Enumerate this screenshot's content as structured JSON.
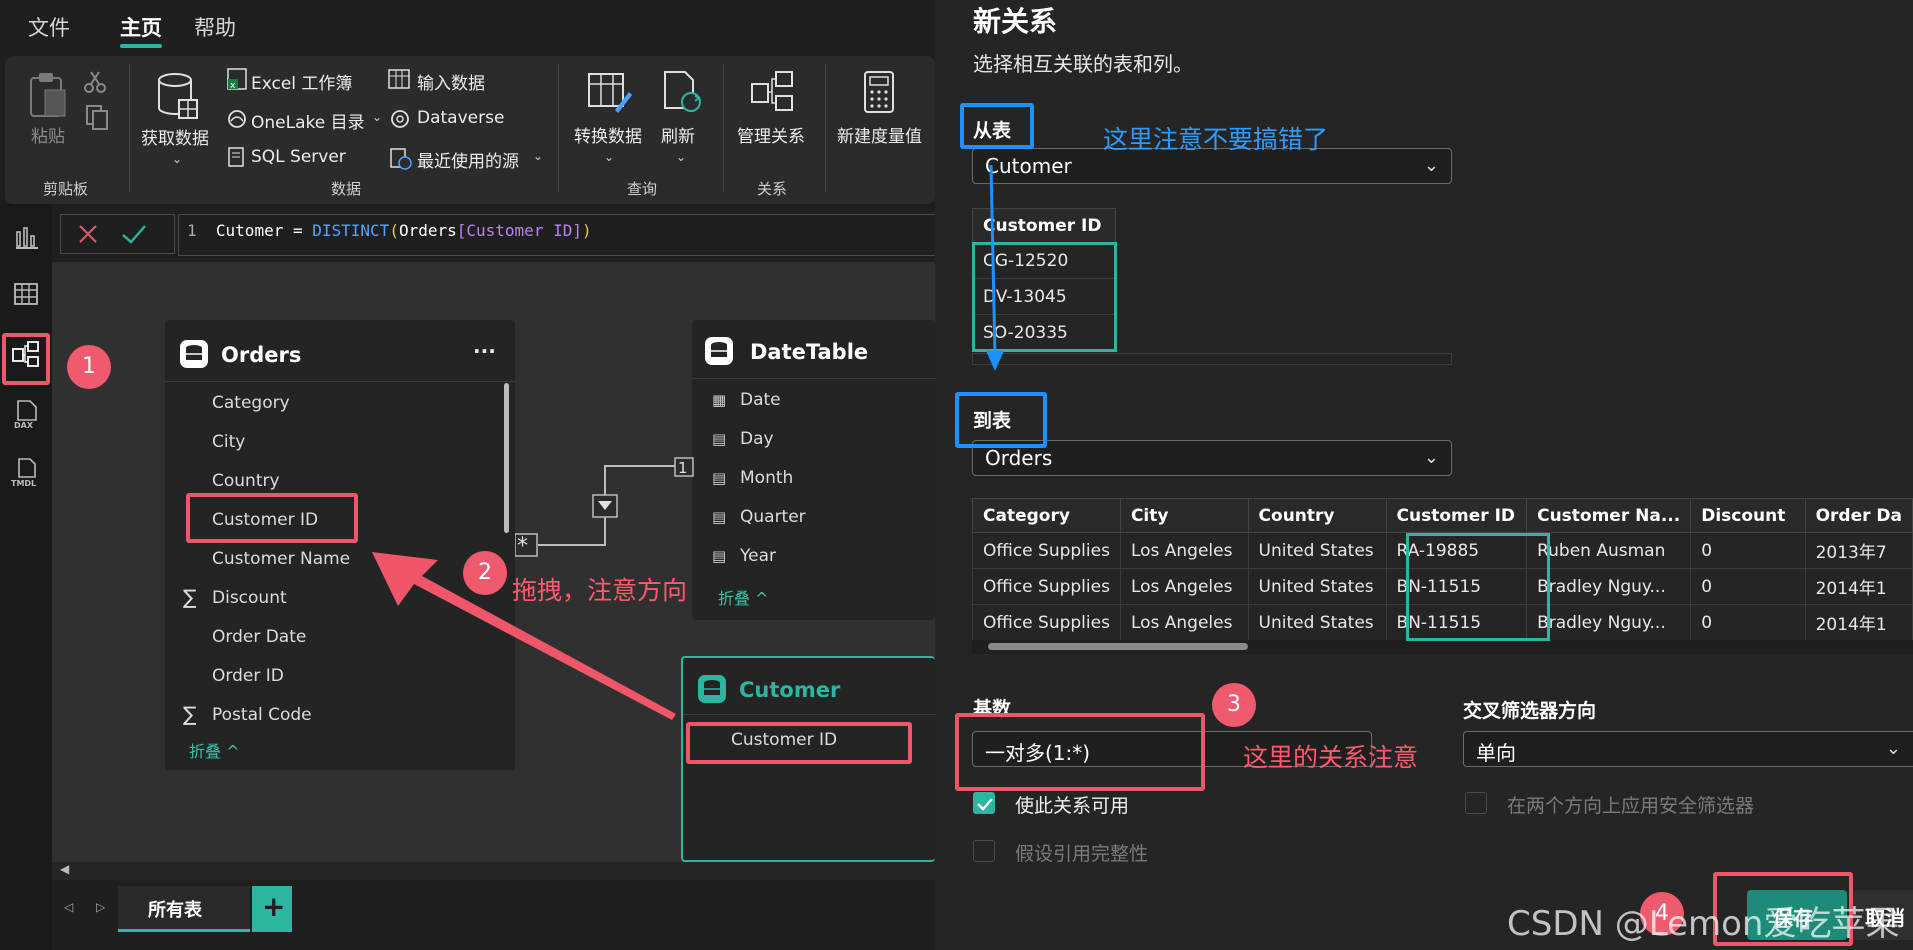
{
  "menu": {
    "file": "文件",
    "home": "主页",
    "help": "帮助"
  },
  "ribbon": {
    "clipboard": {
      "paste": "粘贴",
      "group": "剪贴板"
    },
    "data": {
      "get_data": "获取数据",
      "excel": "Excel 工作簿",
      "onelake": "OneLake 目录",
      "sqlserver": "SQL Server",
      "enter_data": "输入数据",
      "dataverse": "Dataverse",
      "recent": "最近使用的源",
      "group": "数据"
    },
    "query": {
      "transform": "转换数据",
      "refresh": "刷新",
      "group": "查询"
    },
    "relations": {
      "manage": "管理关系",
      "group": "关系"
    },
    "calc": {
      "new_measure": "新建度量值"
    }
  },
  "formula": {
    "line_no": "1",
    "name": "Cutomer",
    "eq": " = ",
    "func": "DISTINCT",
    "open": "(",
    "table": "Orders",
    "bracket": "[Customer ID]",
    "close": ")"
  },
  "canvas": {
    "orders": {
      "title": "Orders",
      "more": "···",
      "fields": [
        "Category",
        "City",
        "Country",
        "Customer ID",
        "Customer Name",
        "Discount",
        "Order Date",
        "Order ID",
        "Postal Code"
      ],
      "collapse": "折叠 ^"
    },
    "datetable": {
      "title": "DateTable",
      "fields": [
        "Date",
        "Day",
        "Month",
        "Quarter",
        "Year"
      ],
      "collapse": "折叠 ^"
    },
    "cutomer": {
      "title": "Cutomer",
      "fields": [
        "Customer ID"
      ]
    },
    "rel_many": "*",
    "rel_one": "1"
  },
  "tabs": {
    "all_tables": "所有表",
    "add": "+"
  },
  "dialog": {
    "title": "新关系",
    "subtitle": "选择相互关联的表和列。",
    "from_label": "从表",
    "from_table": "Cutomer",
    "from_grid": {
      "header": "Customer ID",
      "rows": [
        "CG-12520",
        "DV-13045",
        "SO-20335"
      ]
    },
    "to_label": "到表",
    "to_table": "Orders",
    "to_grid": {
      "headers": [
        "Category",
        "City",
        "Country",
        "Customer ID",
        "Customer Na...",
        "Discount",
        "Order Da"
      ],
      "rows": [
        [
          "Office Supplies",
          "Los Angeles",
          "United States",
          "RA-19885",
          "Ruben Ausman",
          "0",
          "2013年7"
        ],
        [
          "Office Supplies",
          "Los Angeles",
          "United States",
          "BN-11515",
          "Bradley Nguy...",
          "0",
          "2014年1"
        ],
        [
          "Office Supplies",
          "Los Angeles",
          "United States",
          "BN-11515",
          "Bradley Nguy...",
          "0",
          "2014年1"
        ]
      ]
    },
    "cardinality_label": "基数",
    "cardinality_value": "一对多(1:*)",
    "crossfilter_label": "交叉筛选器方向",
    "crossfilter_value": "单向",
    "enable_rel": "使此关系可用",
    "referential": "假设引用完整性",
    "security_both": "在两个方向上应用安全筛选器",
    "save": "保存",
    "cancel": "取消"
  },
  "annotations": {
    "n1": "1",
    "n2": "2",
    "n3": "3",
    "n4": "4",
    "drag_note": "拖拽，注意方向",
    "table_note": "这里注意不要搞错了",
    "card_note": "这里的关系注意"
  },
  "watermark": "CSDN @Lemon爱吃苹果",
  "colors": {
    "accent": "#2cb5a0",
    "annotation_red": "#f0566a",
    "annotation_blue": "#1e90ff"
  }
}
